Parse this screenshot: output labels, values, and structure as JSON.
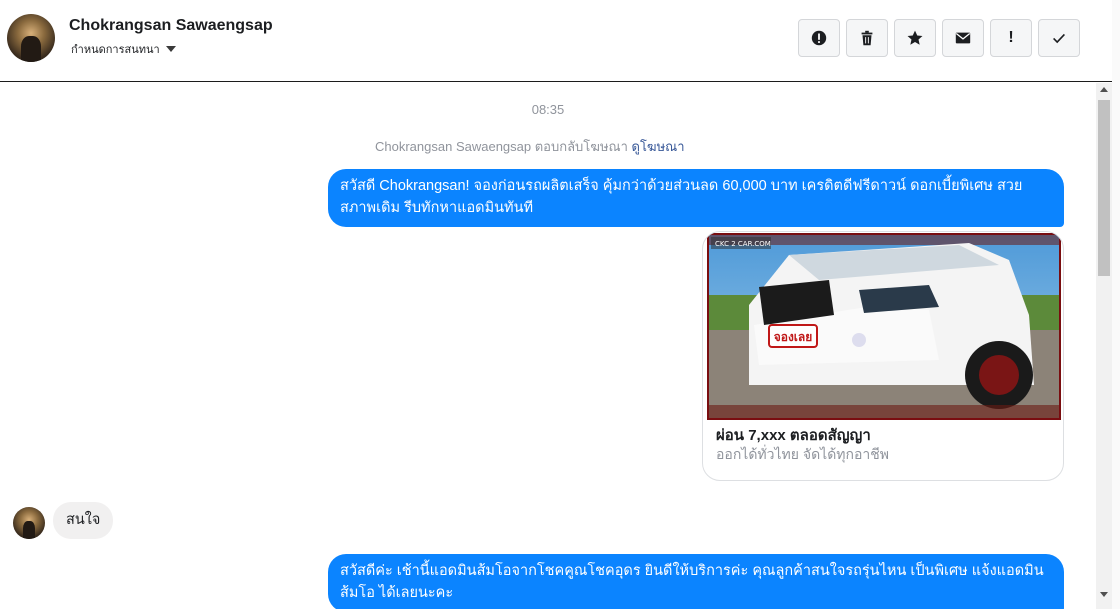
{
  "header": {
    "name": "Chokrangsan Sawaengsap",
    "settings_label": "กำหนดการสนทนา",
    "actions": [
      "info-alert",
      "trash",
      "star",
      "envelope",
      "exclamation",
      "check"
    ],
    "exclamation_label": "!"
  },
  "thread": {
    "timestamp": "08:35",
    "reply_note_text": "Chokrangsan Sawaengsap ตอบกลับโฆษณา",
    "reply_note_link": "ดูโฆษณา",
    "messages": [
      {
        "direction": "outgoing",
        "text": "สวัสดี Chokrangsan! จองก่อนรถผลิตเสร็จ คุ้มกว่าด้วยส่วนลด 60,000 บาท เครดิตดีฟรีดาวน์ ดอกเบี้ยพิเศษ สวยสภาพเดิม รีบทักหาแอดมินทันที"
      },
      {
        "direction": "outgoing",
        "type": "ad-card",
        "image_watermark": "CKC 2 CAR.COM",
        "image_badge": "จองเลย",
        "title": "ผ่อน 7,xxx ตลอดสัญญา",
        "subtitle": "ออกได้ทั่วไทย จัดได้ทุกอาชีพ"
      },
      {
        "direction": "incoming",
        "text": "สนใจ"
      },
      {
        "direction": "outgoing",
        "text": "สวัสดีค่ะ เช้านี้แอดมินส้มโอจากโชคคูณโชคอุดร ยินดีให้บริการค่ะ   คุณลูกค้าสนใจรถรุ่นไหน เป็นพิเศษ แจ้งแอดมินส้มโอ ได้เลยนะคะ"
      }
    ]
  },
  "colors": {
    "outgoing_bubble": "#0b84ff",
    "incoming_bubble": "#f1f0f0",
    "link": "#385898",
    "muted_text": "#90949c"
  }
}
